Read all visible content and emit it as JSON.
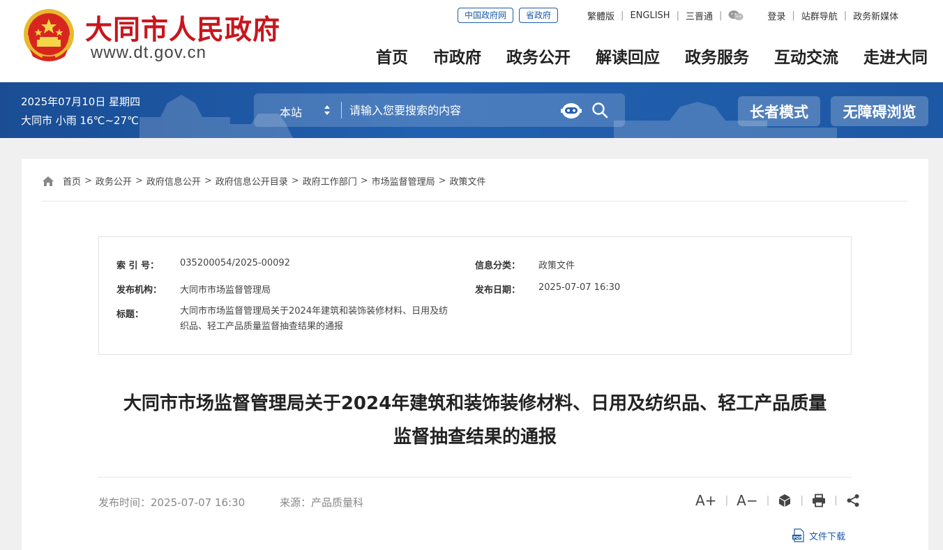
{
  "header": {
    "site_name": "大同市人民政府",
    "site_url": "www.dt.gov.cn",
    "top_links": {
      "pill_1": "中国政府网",
      "pill_2": "省政府",
      "traditional": "繁體版",
      "english": "ENGLISH",
      "sanjintong": "三晋通",
      "login": "登录",
      "sitemap": "站群导航",
      "new_media": "政务新媒体"
    },
    "nav": [
      "首页",
      "市政府",
      "政务公开",
      "解读回应",
      "政务服务",
      "互动交流",
      "走进大同"
    ]
  },
  "bluebar": {
    "date": "2025年07月10日 星期四",
    "weather": "大同市 小雨 16℃~27℃",
    "search": {
      "scope": "本站",
      "placeholder": "请输入您要搜索的内容"
    },
    "elder_mode": "长者模式",
    "accessible": "无障碍浏览"
  },
  "breadcrumb": [
    "首页",
    "政务公开",
    "政府信息公开",
    "政府信息公开目录",
    "政府工作部门",
    "市场监督管理局",
    "政策文件"
  ],
  "meta": {
    "index_label": "索 引 号：",
    "index_value": "035200054/2025-00092",
    "category_label": "信息分类：",
    "category_value": "政策文件",
    "org_label": "发布机构：",
    "org_value": "大同市市场监督管理局",
    "date_label": "发布日期：",
    "date_value": "2025-07-07 16:30",
    "title_label": "标题：",
    "title_value": "大同市市场监督管理局关于2024年建筑和装饰装修材料、日用及纺织品、轻工产品质量监督抽查结果的通报"
  },
  "article": {
    "title_line1": "大同市市场监督管理局关于2024年建筑和装饰装修材料、日用及纺织品、轻工产品质量",
    "title_line2": "监督抽查结果的通报",
    "publish_time": "发布时间：2025-07-07 16:30",
    "source": "来源：产品质量科",
    "font_larger": "A+",
    "font_smaller": "A−",
    "download": "文件下载"
  },
  "colors": {
    "brand_red": "#c8161d",
    "brand_blue": "#1d5aa8"
  }
}
